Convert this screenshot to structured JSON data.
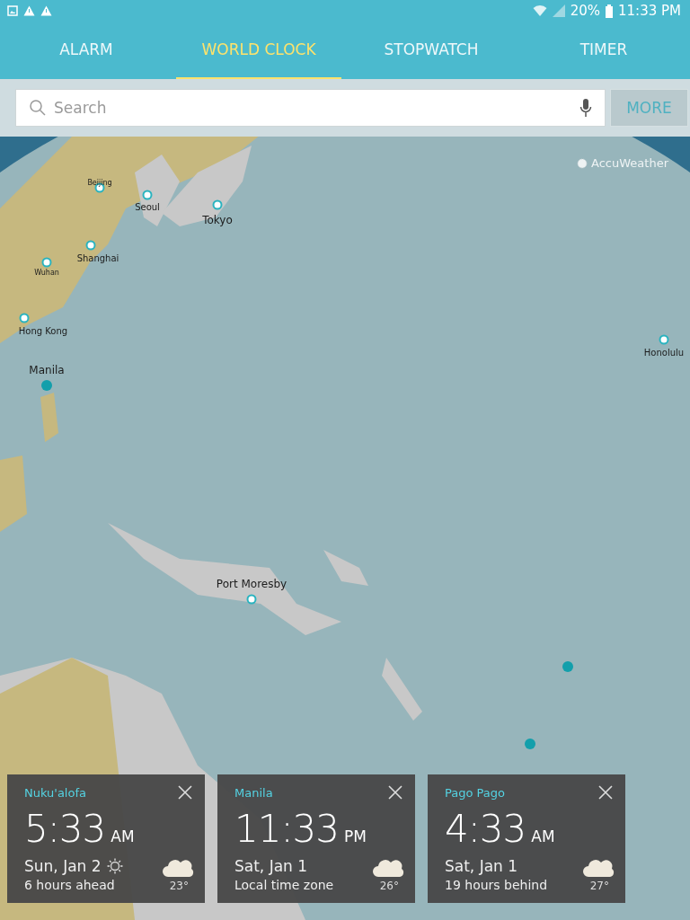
{
  "status_bar": {
    "battery": "20%",
    "time": "11:33 PM"
  },
  "tabs": [
    {
      "label": "ALARM",
      "selected": false
    },
    {
      "label": "WORLD CLOCK",
      "selected": true
    },
    {
      "label": "STOPWATCH",
      "selected": false
    },
    {
      "label": "TIMER",
      "selected": false
    }
  ],
  "search": {
    "placeholder": "Search",
    "more_button": "MORE"
  },
  "map": {
    "attribution": "AccuWeather",
    "cities": [
      {
        "name": "Beijing",
        "kind": "tiny"
      },
      {
        "name": "Seoul",
        "kind": "medium"
      },
      {
        "name": "Tokyo",
        "kind": "major"
      },
      {
        "name": "Shanghai",
        "kind": "medium"
      },
      {
        "name": "Wuhan",
        "kind": "minor"
      },
      {
        "name": "Hong Kong",
        "kind": "medium"
      },
      {
        "name": "Manila",
        "kind": "saved"
      },
      {
        "name": "Honolulu",
        "kind": "medium"
      },
      {
        "name": "Port Moresby",
        "kind": "major"
      }
    ]
  },
  "cards": [
    {
      "city": "Nuku'alofa",
      "time": "5:33",
      "period": "AM",
      "date": "Sun, Jan 2",
      "daytime": true,
      "difference": "6 hours ahead",
      "cloudy": true,
      "temperature": "23°"
    },
    {
      "city": "Manila",
      "time": "11:33",
      "period": "PM",
      "date": "Sat, Jan 1",
      "daytime": false,
      "difference": "Local time zone",
      "cloudy": true,
      "temperature": "26°"
    },
    {
      "city": "Pago Pago",
      "time": "4:33",
      "period": "AM",
      "date": "Sat, Jan 1",
      "daytime": false,
      "difference": "19 hours behind",
      "cloudy": true,
      "temperature": "27°"
    }
  ]
}
